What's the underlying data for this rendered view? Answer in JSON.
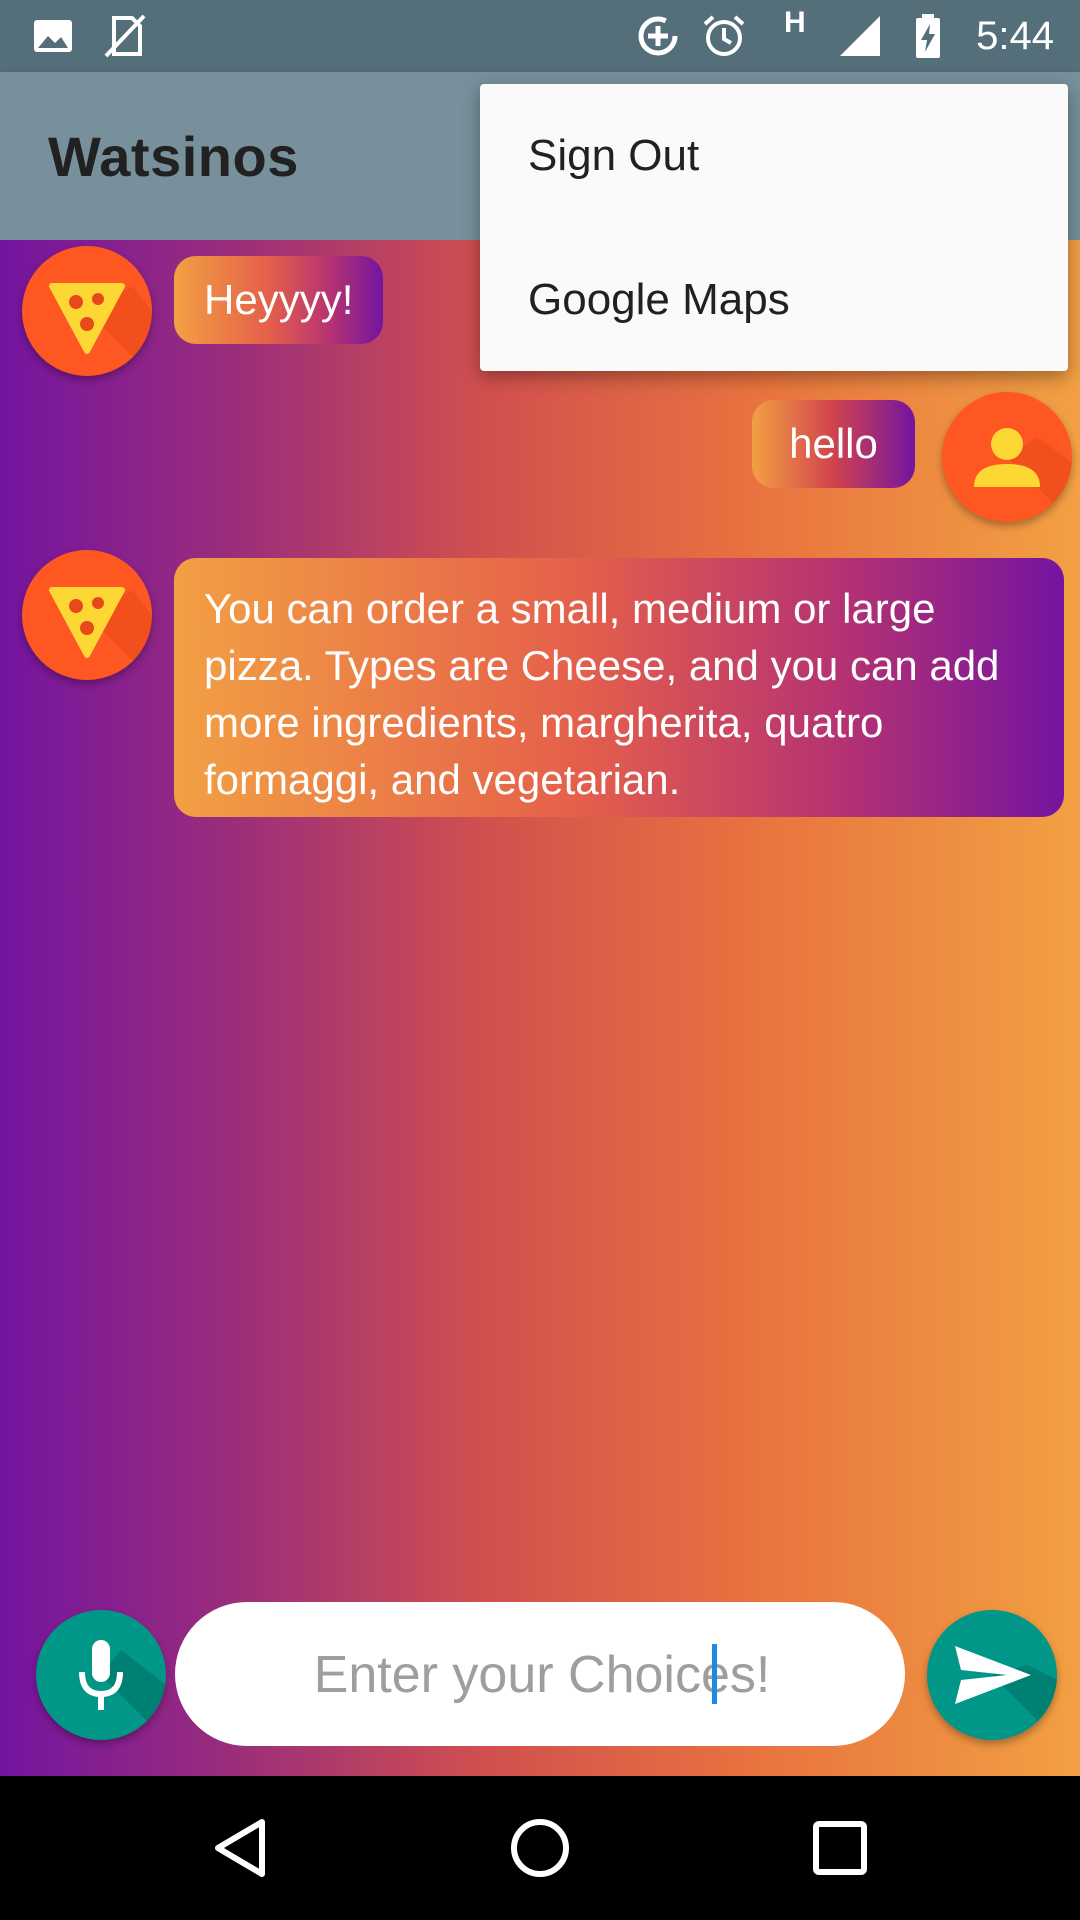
{
  "status_bar": {
    "time": "5:44",
    "network_label": "H",
    "icons": [
      "image-icon",
      "sim-off-icon",
      "data-saver-icon",
      "alarm-icon",
      "network-type-icon",
      "signal-icon",
      "battery-charging-icon"
    ]
  },
  "app_bar": {
    "title": "Watsinos"
  },
  "menu": {
    "items": [
      {
        "label": "Sign Out"
      },
      {
        "label": "Google Maps"
      }
    ]
  },
  "messages": [
    {
      "sender": "bot",
      "avatar": "pizza-icon",
      "text": "Heyyyy!"
    },
    {
      "sender": "user",
      "avatar": "person-icon",
      "text": "hello"
    },
    {
      "sender": "bot",
      "avatar": "pizza-icon",
      "text": "You can order a small, medium or large pizza. Types are Cheese, and you can add more ingredients, margherita, quatro formaggi, and vegetarian."
    }
  ],
  "input": {
    "placeholder": "Enter your Choices!"
  },
  "colors": {
    "status_bar": "#546e7a",
    "app_bar": "#78909c",
    "avatar": "#ff5722",
    "action_button": "#009688",
    "gradient_start": "#7414a0",
    "gradient_end": "#f2a043"
  },
  "nav_bar": {
    "icons": [
      "back-icon",
      "home-icon",
      "recents-icon"
    ]
  }
}
